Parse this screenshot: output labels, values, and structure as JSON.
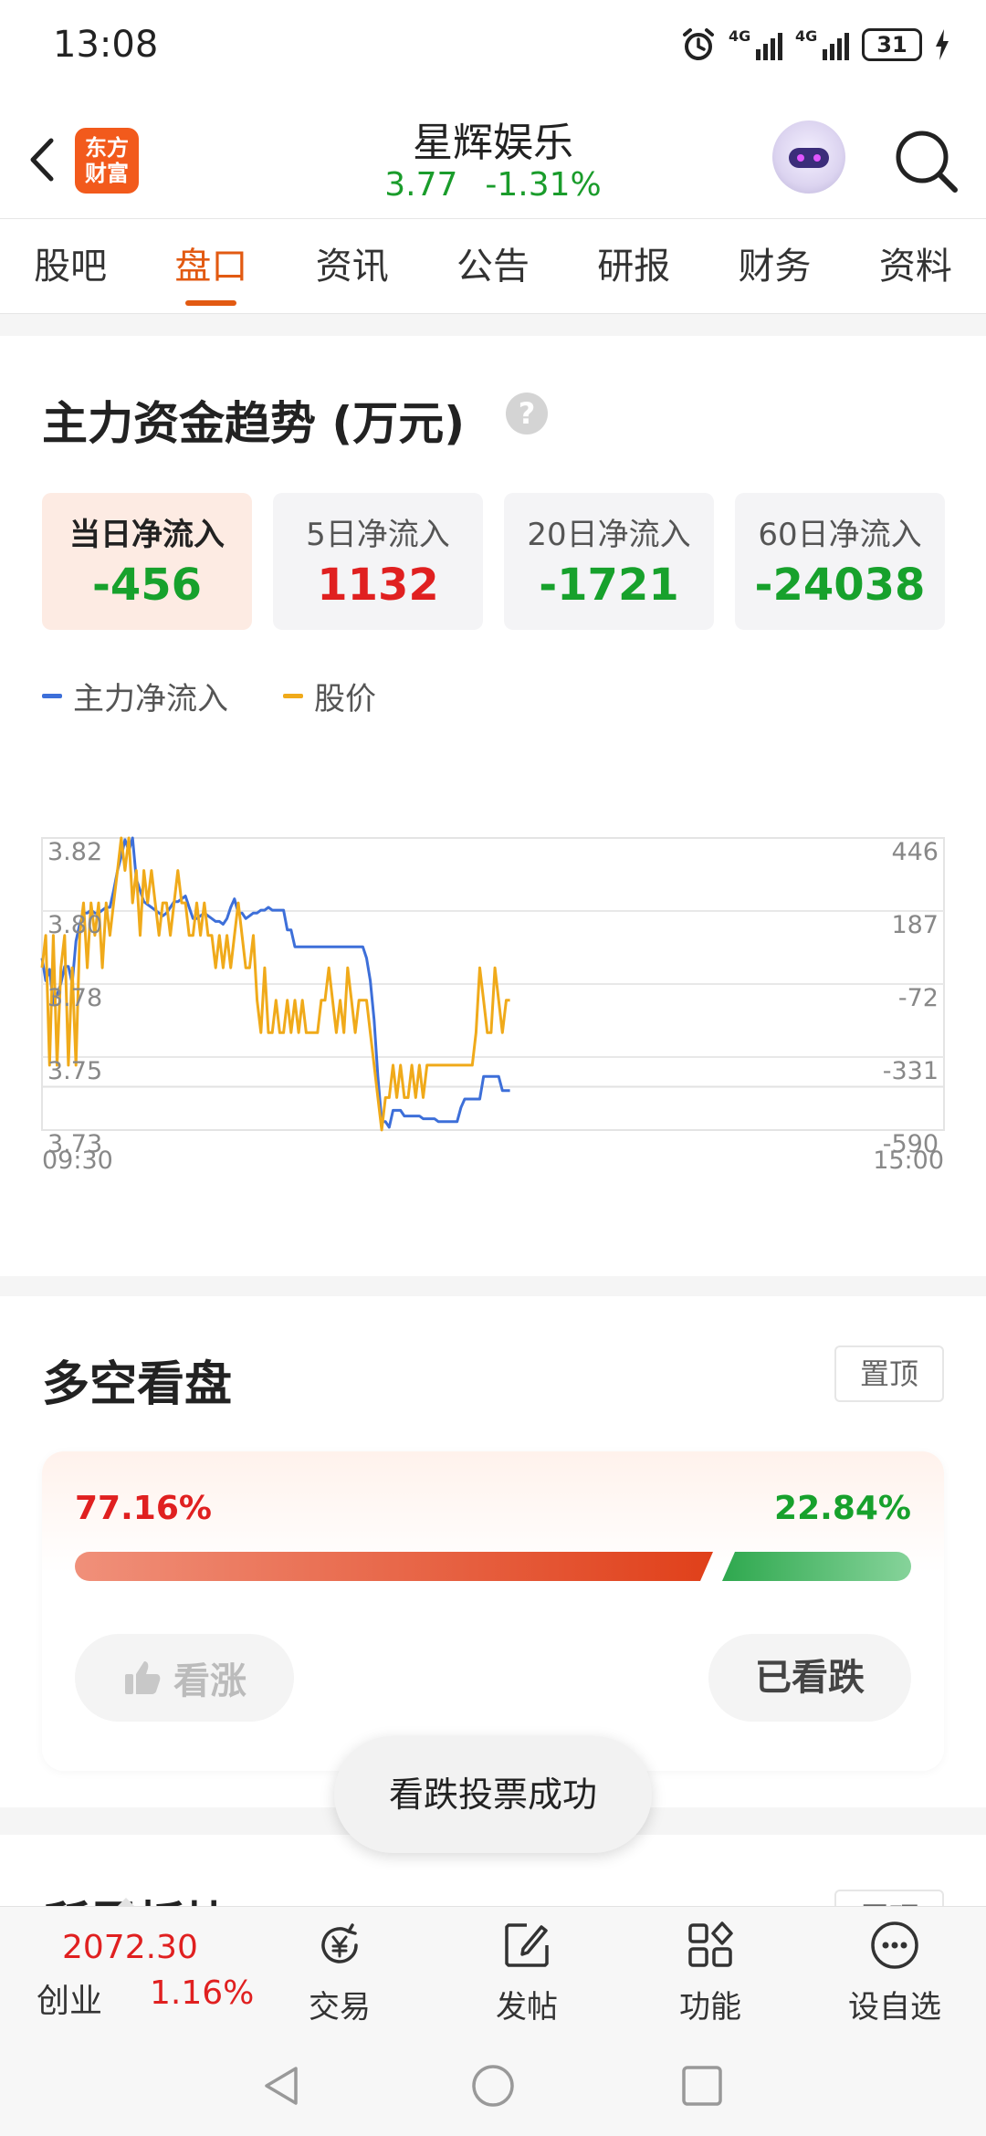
{
  "status_bar": {
    "time": "13:08",
    "net1": "4G",
    "net2": "4G",
    "battery": "31"
  },
  "header": {
    "brand_logo": "东方财富",
    "stock_name": "星辉娱乐",
    "price": "3.77",
    "change_pct": "-1.31%",
    "icons": [
      "back-icon",
      "assistant-avatar",
      "search-icon"
    ]
  },
  "tabs": [
    {
      "label": "股吧",
      "active": false
    },
    {
      "label": "盘口",
      "active": true
    },
    {
      "label": "资讯",
      "active": false
    },
    {
      "label": "公告",
      "active": false
    },
    {
      "label": "研报",
      "active": false
    },
    {
      "label": "财务",
      "active": false
    },
    {
      "label": "资料",
      "active": false
    }
  ],
  "capital_flow": {
    "title": "主力资金趋势 (万元)",
    "help": "?",
    "boxes": [
      {
        "label": "当日净流入",
        "value": "-456",
        "tone": "neg"
      },
      {
        "label": "5日净流入",
        "value": "1132",
        "tone": "pos"
      },
      {
        "label": "20日净流入",
        "value": "-1721",
        "tone": "neg"
      },
      {
        "label": "60日净流入",
        "value": "-24038",
        "tone": "neg"
      }
    ],
    "legend": [
      {
        "name": "主力净流入",
        "color": "#3d6fd9"
      },
      {
        "name": "股价",
        "color": "#f0aa1a"
      }
    ]
  },
  "chart_data": {
    "type": "line",
    "title": "",
    "xlabel": "",
    "ylabel": "",
    "x_tick_labels": [
      "09:30",
      "15:00"
    ],
    "y_left_ticks": [
      "3.82",
      "3.80",
      "3.78",
      "3.75",
      "3.73"
    ],
    "y_right_ticks": [
      "446",
      "187",
      "-72",
      "-331",
      "-590"
    ],
    "ylim_left": [
      3.73,
      3.82
    ],
    "ylim_right": [
      -590,
      446
    ],
    "n_points_full_day": 240,
    "grid": true,
    "series": [
      {
        "name": "主力净流入",
        "axis": "right",
        "color": "#3d6fd9",
        "values": [
          20,
          -60,
          -20,
          -140,
          -110,
          -70,
          -10,
          -10,
          -70,
          80,
          140,
          180,
          180,
          190,
          180,
          180,
          190,
          200,
          200,
          260,
          330,
          380,
          440,
          400,
          446,
          300,
          260,
          220,
          210,
          200,
          190,
          180,
          170,
          180,
          200,
          220,
          220,
          230,
          240,
          200,
          160,
          160,
          170,
          180,
          170,
          160,
          150,
          150,
          140,
          160,
          200,
          230,
          180,
          180,
          160,
          170,
          180,
          180,
          190,
          190,
          200,
          190,
          190,
          190,
          190,
          120,
          120,
          60,
          60,
          60,
          60,
          60,
          60,
          60,
          60,
          60,
          60,
          60,
          60,
          60,
          60,
          60,
          60,
          60,
          60,
          60,
          20,
          -60,
          -200,
          -400,
          -560,
          -560,
          -580,
          -520,
          -520,
          -520,
          -540,
          -540,
          -540,
          -540,
          -540,
          -550,
          -550,
          -550,
          -550,
          -560,
          -560,
          -560,
          -560,
          -560,
          -560,
          -510,
          -480,
          -480,
          -480,
          -480,
          -480,
          -400,
          -400,
          -400,
          -400,
          -400,
          -450,
          -450,
          -450
        ]
      },
      {
        "name": "股价",
        "axis": "left",
        "color": "#f0aa1a",
        "values": [
          3.78,
          3.79,
          3.75,
          3.79,
          3.75,
          3.78,
          3.79,
          3.75,
          3.78,
          3.75,
          3.79,
          3.8,
          3.78,
          3.8,
          3.79,
          3.8,
          3.78,
          3.8,
          3.79,
          3.8,
          3.81,
          3.82,
          3.81,
          3.82,
          3.8,
          3.81,
          3.79,
          3.81,
          3.8,
          3.81,
          3.8,
          3.79,
          3.8,
          3.8,
          3.79,
          3.8,
          3.81,
          3.8,
          3.8,
          3.79,
          3.79,
          3.8,
          3.79,
          3.8,
          3.79,
          3.79,
          3.78,
          3.79,
          3.78,
          3.79,
          3.78,
          3.79,
          3.8,
          3.79,
          3.78,
          3.78,
          3.79,
          3.77,
          3.76,
          3.78,
          3.76,
          3.76,
          3.77,
          3.76,
          3.76,
          3.77,
          3.76,
          3.77,
          3.76,
          3.77,
          3.76,
          3.76,
          3.76,
          3.76,
          3.77,
          3.77,
          3.78,
          3.77,
          3.76,
          3.77,
          3.76,
          3.78,
          3.77,
          3.76,
          3.77,
          3.77,
          3.77,
          3.76,
          3.75,
          3.74,
          3.73,
          3.74,
          3.74,
          3.75,
          3.74,
          3.75,
          3.74,
          3.74,
          3.75,
          3.74,
          3.75,
          3.74,
          3.75,
          3.75,
          3.75,
          3.75,
          3.75,
          3.75,
          3.75,
          3.75,
          3.75,
          3.75,
          3.75,
          3.75,
          3.75,
          3.76,
          3.78,
          3.77,
          3.76,
          3.76,
          3.78,
          3.77,
          3.76,
          3.77,
          3.77
        ]
      }
    ]
  },
  "sentiment": {
    "title": "多空看盘",
    "pin_label": "置顶",
    "bull_pct": "77.16%",
    "bear_pct": "22.84%",
    "bull_fraction": 0.7716,
    "bull_label": "看涨",
    "bear_label": "已看跌"
  },
  "sector": {
    "title": "所属板块",
    "pin_label": "置顶"
  },
  "toast": "看跌投票成功",
  "bottom_bar": {
    "index_value": "2072.30",
    "index_name": "创业",
    "index_change": "1.16%",
    "nav": [
      {
        "label": "交易",
        "icon": "trade-yen-icon"
      },
      {
        "label": "发帖",
        "icon": "compose-icon"
      },
      {
        "label": "功能",
        "icon": "grid-apps-icon"
      },
      {
        "label": "设自选",
        "icon": "more-dots-icon"
      }
    ]
  },
  "system_nav": [
    "back-triangle-icon",
    "home-circle-icon",
    "recents-square-icon"
  ]
}
